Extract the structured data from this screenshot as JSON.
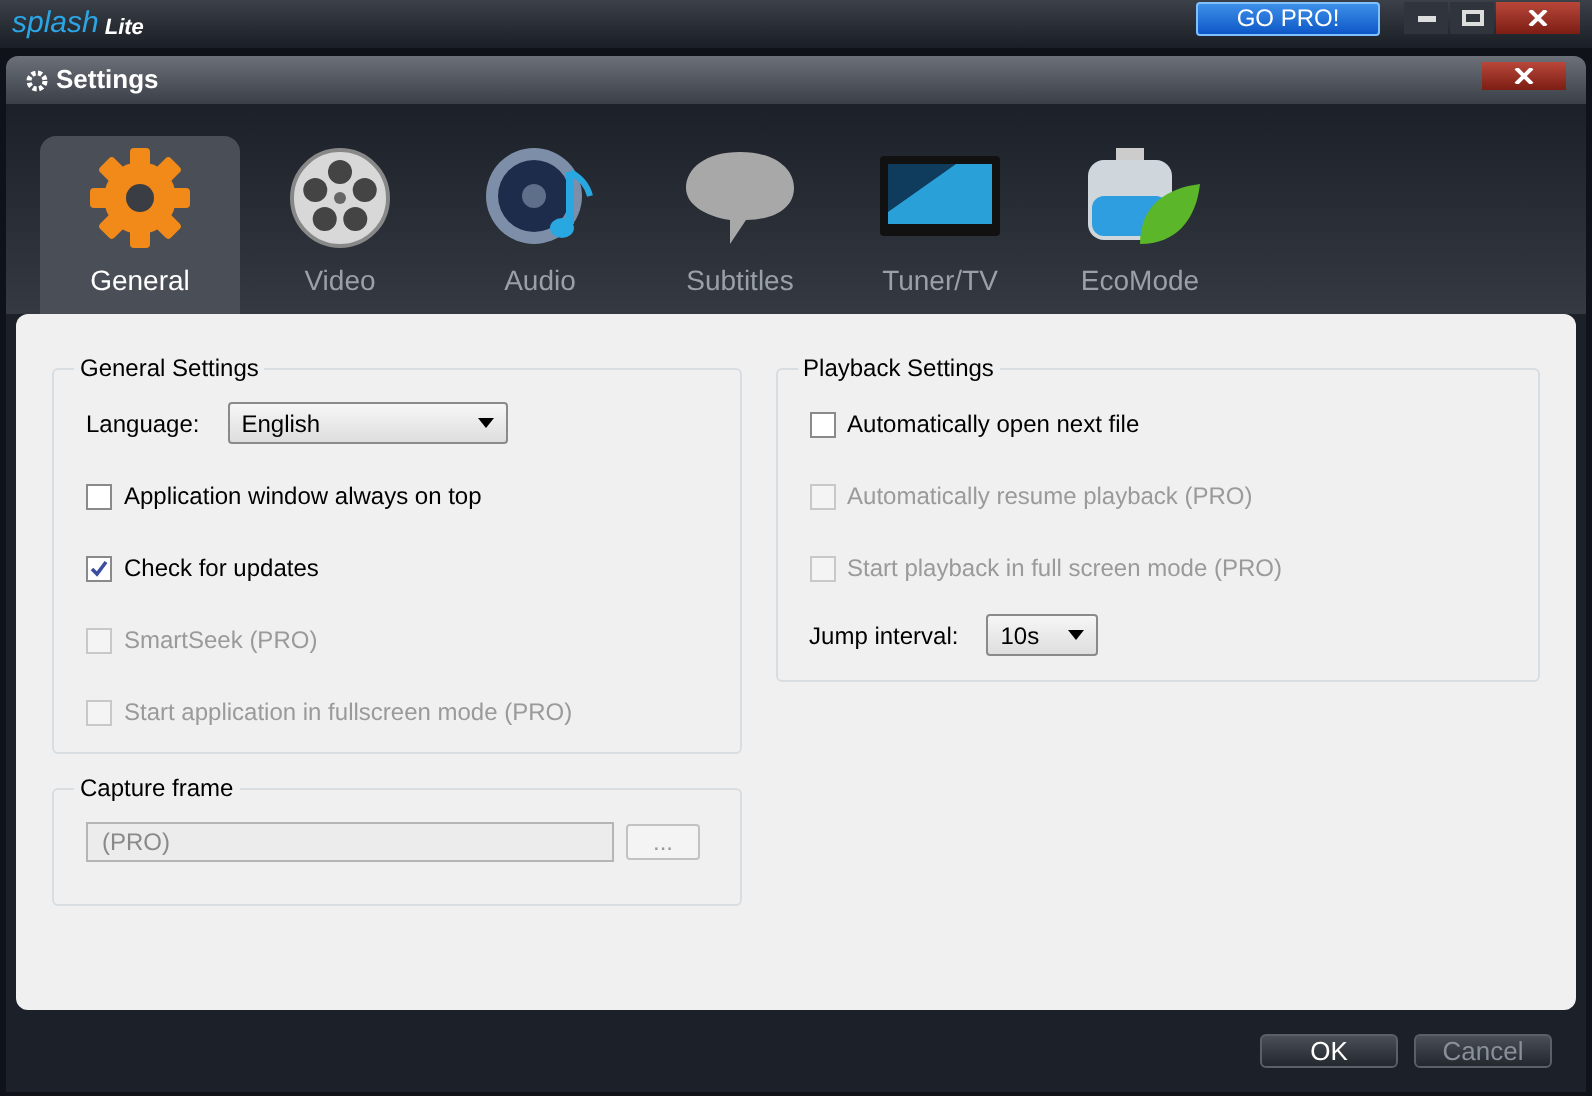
{
  "app_bar": {
    "logo": "splash",
    "edition": "Lite",
    "go_pro": "GO PRO!"
  },
  "dialog": {
    "title": "Settings"
  },
  "tabs": [
    {
      "label": "General",
      "selected": true
    },
    {
      "label": "Video",
      "selected": false
    },
    {
      "label": "Audio",
      "selected": false
    },
    {
      "label": "Subtitles",
      "selected": false
    },
    {
      "label": "Tuner/TV",
      "selected": false
    },
    {
      "label": "EcoMode",
      "selected": false
    }
  ],
  "general_settings": {
    "title": "General Settings",
    "language_label": "Language:",
    "language": "English",
    "options": [
      {
        "label": "Application window always on top",
        "checked": false,
        "disabled": false
      },
      {
        "label": "Check for updates",
        "checked": true,
        "disabled": false
      },
      {
        "label": "SmartSeek (PRO)",
        "checked": false,
        "disabled": true
      },
      {
        "label": "Start application in fullscreen mode (PRO)",
        "checked": false,
        "disabled": true
      }
    ]
  },
  "capture_frame": {
    "title": "Capture frame",
    "path": "(PRO)",
    "browse": "..."
  },
  "playback_settings": {
    "title": "Playback Settings",
    "options": [
      {
        "label": "Automatically open next file",
        "checked": false,
        "disabled": false
      },
      {
        "label": "Automatically resume playback (PRO)",
        "checked": false,
        "disabled": true
      },
      {
        "label": "Start playback in full screen mode (PRO)",
        "checked": false,
        "disabled": true
      }
    ],
    "jump_label": "Jump interval:",
    "jump": "10s"
  },
  "buttons": [
    {
      "label": "OK",
      "disabled": false
    },
    {
      "label": "Cancel",
      "disabled": true
    }
  ]
}
